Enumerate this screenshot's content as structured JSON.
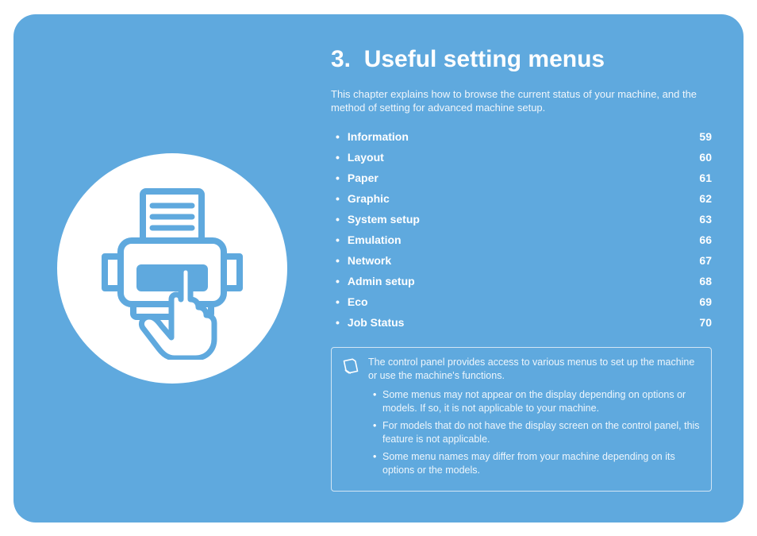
{
  "chapter": {
    "number": "3.",
    "title": "Useful setting menus",
    "intro": "This chapter explains how to browse the current status of your machine, and the method of setting for advanced machine setup."
  },
  "toc": [
    {
      "label": "Information",
      "page": "59"
    },
    {
      "label": "Layout",
      "page": "60"
    },
    {
      "label": "Paper",
      "page": "61"
    },
    {
      "label": "Graphic",
      "page": "62"
    },
    {
      "label": "System setup",
      "page": "63"
    },
    {
      "label": "Emulation",
      "page": "66"
    },
    {
      "label": "Network",
      "page": "67"
    },
    {
      "label": "Admin setup",
      "page": "68"
    },
    {
      "label": "Eco",
      "page": "69"
    },
    {
      "label": "Job Status",
      "page": "70"
    }
  ],
  "note": {
    "lead": "The control panel provides access to various menus to set up the machine or use the machine's functions.",
    "bullets": [
      "Some menus may not appear on the display depending on options or models. If so, it is not applicable to your machine.",
      "For models that do not have the display screen on the control panel, this feature is not applicable.",
      "Some menu names may differ from your machine depending on its options or the models."
    ]
  }
}
